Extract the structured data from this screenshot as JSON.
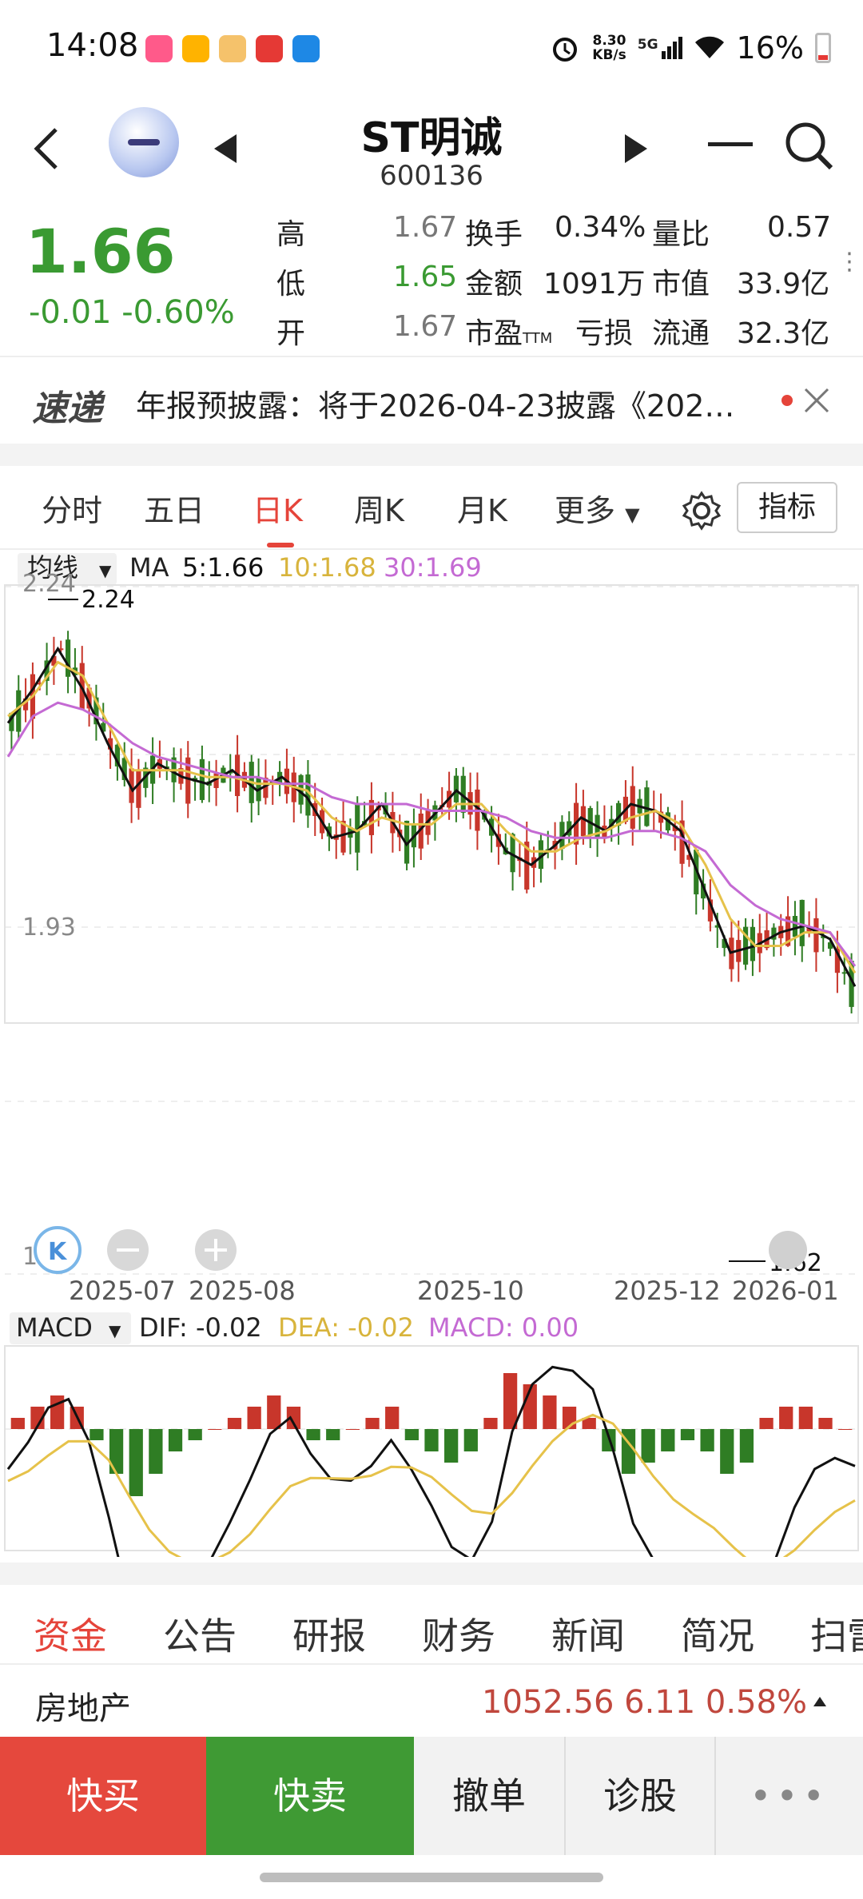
{
  "status_bar": {
    "time": "14:08",
    "net_speed_value": "8.30",
    "net_speed_unit": "KB/s",
    "network": "5G",
    "battery": "16%",
    "app_icon_colors": [
      "#ff5a8a",
      "#ffb300",
      "#f39c12",
      "#e53935",
      "#1e88e5"
    ]
  },
  "header": {
    "stock_name": "ST明诚",
    "stock_code": "600136",
    "icons": [
      "back-arrow-icon",
      "mascot-avatar",
      "prev-stock-icon",
      "next-stock-icon",
      "minus-icon",
      "search-icon"
    ]
  },
  "quote": {
    "price": "1.66",
    "change": "-0.01  -0.60%",
    "rows": [
      {
        "l1": "高",
        "v1": "1.67",
        "l2": "换手",
        "v2": "0.34%",
        "l3": "量比",
        "v3": "0.57"
      },
      {
        "l1": "低",
        "v1": "1.65",
        "l2": "金额",
        "v2": "1091万",
        "l3": "市值",
        "v3": "33.9亿"
      },
      {
        "l1": "开",
        "v1": "1.67",
        "l2": "市盈",
        "l2_sub": "TTM",
        "v2": "亏损",
        "l3": "流通",
        "v3": "32.3亿"
      }
    ]
  },
  "ticker": {
    "logo": "速递",
    "text": "年报预披露：将于2026-04-23披露《202…"
  },
  "period_tabs": {
    "items": [
      "分时",
      "五日",
      "日K",
      "周K",
      "月K",
      "更多"
    ],
    "active": "日K",
    "indicator_button": "指标"
  },
  "kline": {
    "ma_selector": "均线",
    "ma_label": "MA",
    "ma5": "5:1.66",
    "ma10": "10:1.68",
    "ma30": "30:1.69",
    "y_labels": [
      "2.24",
      "1.93",
      "1.62"
    ],
    "high_marker": "2.24",
    "low_marker": "1.62",
    "x_labels": [
      "2025-07",
      "2025-08",
      "2025-10",
      "2025-12",
      "2026-01"
    ],
    "colors": {
      "up": "#c8362b",
      "down": "#2f7d24",
      "ma5": "#111111",
      "ma10": "#e6c24a",
      "ma30": "#c46ad3"
    }
  },
  "macd": {
    "selector": "MACD",
    "dif": "DIF: -0.02",
    "dea": "DEA: -0.02",
    "macd": "MACD: 0.00"
  },
  "chart_data": {
    "type": "candlestick",
    "y_range": [
      1.62,
      2.24
    ],
    "series": [
      {
        "name": "MA5",
        "values": [
          2.05,
          2.1,
          2.16,
          2.1,
          2.02,
          1.95,
          1.99,
          1.97,
          1.96,
          1.98,
          1.95,
          1.97,
          1.94,
          1.88,
          1.89,
          1.93,
          1.87,
          1.91,
          1.95,
          1.92,
          1.86,
          1.84,
          1.87,
          1.91,
          1.89,
          1.93,
          1.92,
          1.89,
          1.8,
          1.71,
          1.72,
          1.74,
          1.75,
          1.73,
          1.66
        ]
      },
      {
        "name": "MA10",
        "values": [
          2.06,
          2.09,
          2.14,
          2.12,
          2.05,
          1.98,
          1.98,
          1.98,
          1.97,
          1.97,
          1.96,
          1.96,
          1.95,
          1.91,
          1.89,
          1.91,
          1.9,
          1.9,
          1.93,
          1.93,
          1.89,
          1.86,
          1.86,
          1.88,
          1.89,
          1.91,
          1.92,
          1.9,
          1.84,
          1.76,
          1.72,
          1.72,
          1.74,
          1.74,
          1.68
        ]
      },
      {
        "name": "MA30",
        "values": [
          2.0,
          2.06,
          2.08,
          2.07,
          2.05,
          2.02,
          2.0,
          1.99,
          1.98,
          1.97,
          1.97,
          1.96,
          1.96,
          1.94,
          1.93,
          1.93,
          1.93,
          1.92,
          1.92,
          1.92,
          1.91,
          1.89,
          1.88,
          1.88,
          1.88,
          1.89,
          1.89,
          1.88,
          1.86,
          1.81,
          1.78,
          1.76,
          1.75,
          1.74,
          1.69
        ]
      }
    ],
    "macd_hist": [
      0.01,
      0.02,
      0.03,
      0.02,
      -0.01,
      -0.04,
      -0.06,
      -0.04,
      -0.02,
      -0.01,
      0,
      0.01,
      0.02,
      0.03,
      0.02,
      -0.01,
      -0.01,
      0,
      0.01,
      0.02,
      -0.01,
      -0.02,
      -0.03,
      -0.02,
      0.01,
      0.05,
      0.04,
      0.03,
      0.02,
      0.01,
      -0.02,
      -0.04,
      -0.03,
      -0.02,
      -0.01,
      -0.02,
      -0.04,
      -0.03,
      0.01,
      0.02,
      0.02,
      0.01,
      0
    ]
  },
  "info_tabs": {
    "items": [
      "资金",
      "公告",
      "研报",
      "财务",
      "新闻",
      "简况",
      "扫雷"
    ],
    "active": "资金"
  },
  "sector": {
    "name": "房地产",
    "values": "1052.56  6.11  0.58%"
  },
  "actions": {
    "buy": "快买",
    "sell": "快卖",
    "cancel": "撤单",
    "diagnose": "诊股",
    "more": "•••"
  }
}
